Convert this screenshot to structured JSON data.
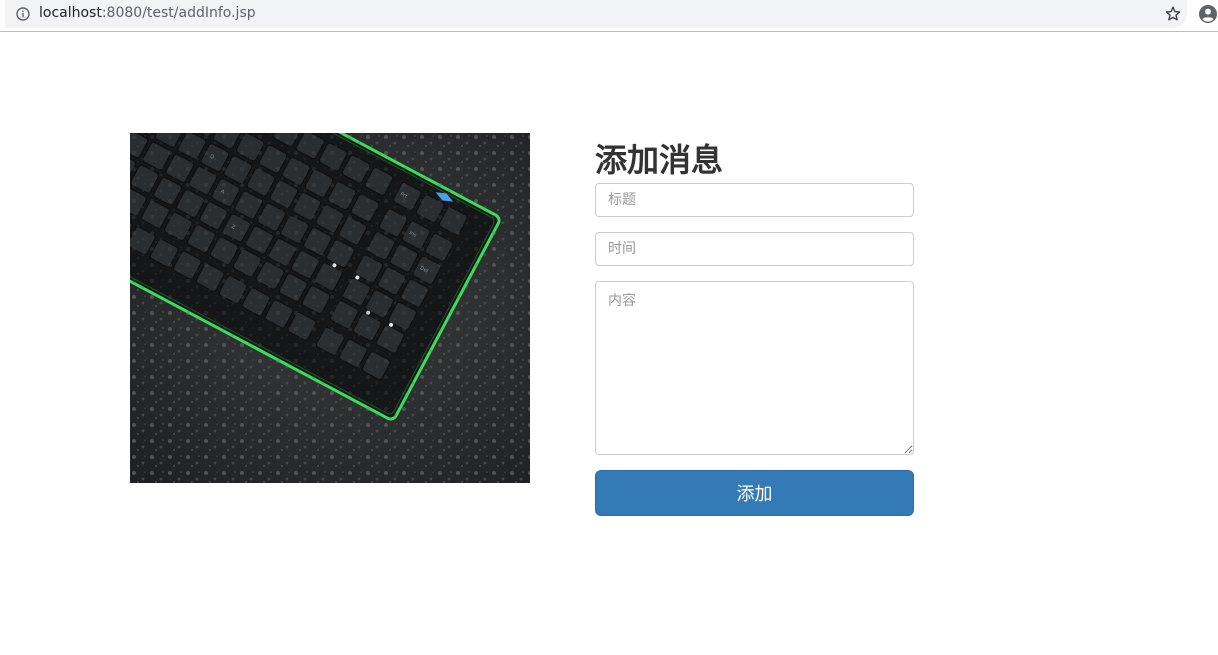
{
  "browser": {
    "url_host": "localhost",
    "url_rest": ":8080/test/addInfo.jsp",
    "icons": [
      "info-icon",
      "star-icon",
      "account-icon"
    ]
  },
  "image": {
    "description_icon": "keyboard-photo"
  },
  "form": {
    "heading": "添加消息",
    "title_placeholder": "标题",
    "time_placeholder": "时间",
    "content_placeholder": "内容",
    "submit_label": "添加"
  },
  "colors": {
    "primary": "#337ab7",
    "heading": "#333333",
    "border": "#cccccc",
    "keyboard_glow": "#3ddc5a"
  }
}
